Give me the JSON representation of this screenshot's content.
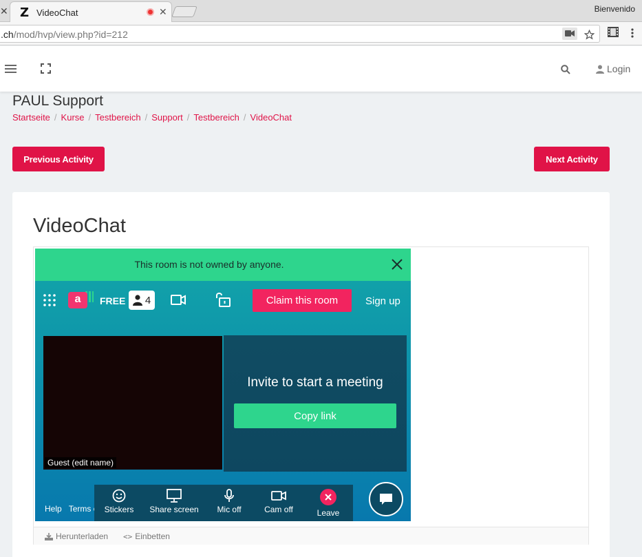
{
  "browser": {
    "tab_title": "VideoChat",
    "tab_favicon": "Z",
    "profile_name": "Bienvenido",
    "url_host": ".ch",
    "url_path": "/mod/hvp/view.php?id=212"
  },
  "header": {
    "login_label": "Login"
  },
  "page": {
    "heading": "PAUL Support",
    "breadcrumb": [
      "Startseite",
      "Kurse",
      "Testbereich",
      "Support",
      "Testbereich",
      "VideoChat"
    ],
    "prev_label": "Previous Activity",
    "next_label": "Next Activity",
    "card_title": "VideoChat",
    "footer": {
      "download_label": "Herunterladen",
      "embed_label": "Einbetten"
    }
  },
  "widget": {
    "notice": "This room is not owned by anyone.",
    "logo_letter": "a",
    "plan": "FREE",
    "participants": "4",
    "claim_label": "Claim this room",
    "signup_label": "Sign up",
    "guest_label": "Guest (edit name)",
    "invite_text": "Invite to start a meeting",
    "copy_link_label": "Copy link",
    "help_label": "Help",
    "terms_label": "Terms of use",
    "controls": {
      "stickers": "Stickers",
      "share_screen": "Share screen",
      "mic_off": "Mic off",
      "cam_off": "Cam off",
      "leave": "Leave"
    }
  },
  "colors": {
    "accent": "#e01347",
    "appear_green": "#2ed58d",
    "appear_pink": "#f2245f"
  }
}
